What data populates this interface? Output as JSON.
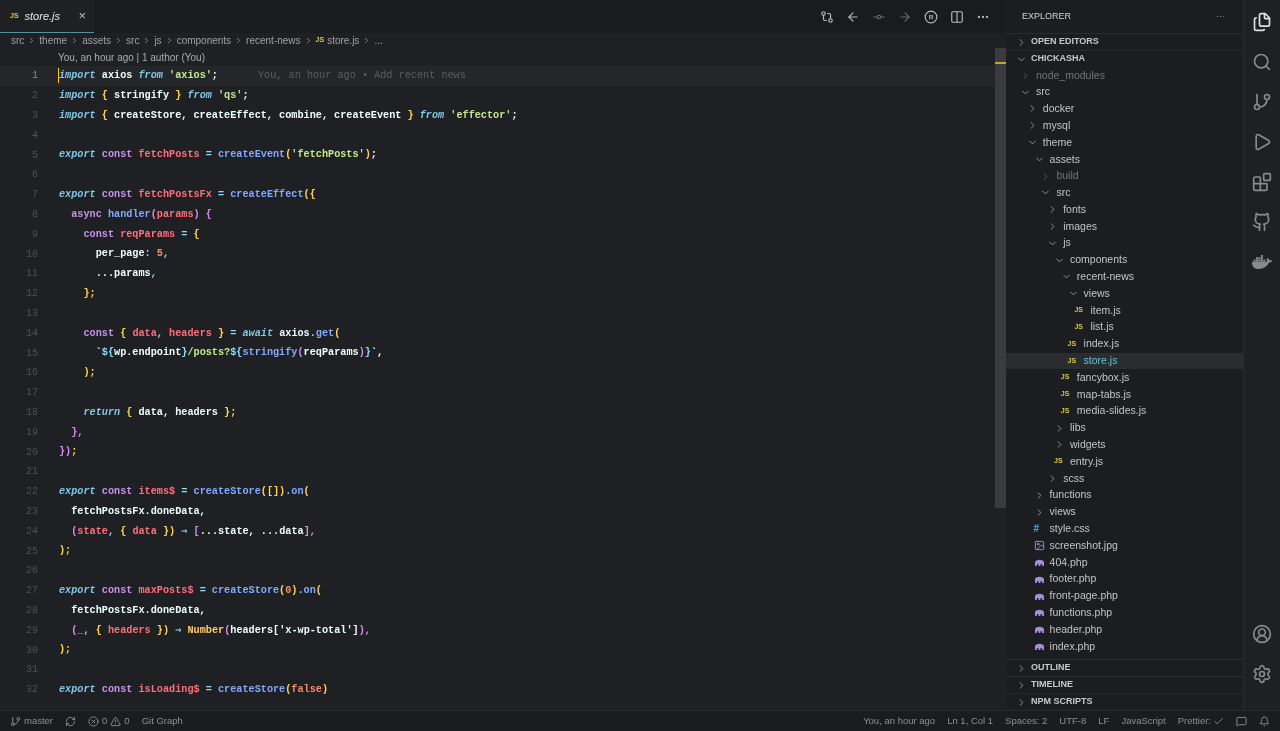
{
  "tab": {
    "icon": "JS",
    "label": "store.js",
    "close": "×",
    "selected": true
  },
  "breadcrumbs": [
    {
      "label": "src"
    },
    {
      "label": "theme"
    },
    {
      "label": "assets"
    },
    {
      "label": "src"
    },
    {
      "label": "js"
    },
    {
      "label": "components"
    },
    {
      "label": "recent-news"
    },
    {
      "label": "store.js",
      "icon": "JS"
    },
    {
      "label": "..."
    }
  ],
  "blame_header": "You, an hour ago | 1 author (You)",
  "inline_blame": "You, an hour ago • Add recent news",
  "code_lines": [
    {
      "n": "1",
      "current": true,
      "tokens": [
        {
          "text": "import ",
          "kind": "keyword"
        },
        {
          "text": "axios ",
          "kind": "plain"
        },
        {
          "text": "from ",
          "kind": "keyword"
        },
        {
          "text": "'axios'",
          "kind": "string"
        },
        {
          "text": ";",
          "kind": "plain"
        }
      ]
    },
    {
      "n": "2",
      "current": false,
      "tokens": [
        {
          "text": "import ",
          "kind": "keyword"
        },
        {
          "text": "{ ",
          "kind": "bracket"
        },
        {
          "text": "stringify ",
          "kind": "plain"
        },
        {
          "text": "} ",
          "kind": "bracket"
        },
        {
          "text": "from ",
          "kind": "keyword"
        },
        {
          "text": "'qs'",
          "kind": "string"
        },
        {
          "text": ";",
          "kind": "plain"
        }
      ]
    },
    {
      "n": "3",
      "current": false,
      "tokens": [
        {
          "text": "import ",
          "kind": "keyword"
        },
        {
          "text": "{ ",
          "kind": "bracket"
        },
        {
          "text": "createStore, createEffect, combine, createEvent ",
          "kind": "plain"
        },
        {
          "text": "} ",
          "kind": "bracket"
        },
        {
          "text": "from ",
          "kind": "keyword"
        },
        {
          "text": "'effector'",
          "kind": "string"
        },
        {
          "text": ";",
          "kind": "plain"
        }
      ]
    },
    {
      "n": "4",
      "current": false
    },
    {
      "n": "5",
      "current": false,
      "tokens": [
        {
          "text": "export ",
          "kind": "keyword"
        },
        {
          "text": "const ",
          "kind": "storage"
        },
        {
          "text": "fetchPosts",
          "kind": "variable"
        },
        {
          "text": " = ",
          "kind": "operator"
        },
        {
          "text": "createEvent",
          "kind": "function"
        },
        {
          "text": "(",
          "kind": "bracket"
        },
        {
          "text": "'fetchPosts'",
          "kind": "string"
        },
        {
          "text": ")",
          "kind": "bracket"
        },
        {
          "text": ";",
          "kind": "plain"
        }
      ]
    },
    {
      "n": "6",
      "current": false
    },
    {
      "n": "7",
      "current": false,
      "tokens": [
        {
          "text": "export ",
          "kind": "keyword"
        },
        {
          "text": "const ",
          "kind": "storage"
        },
        {
          "text": "fetchPostsFx",
          "kind": "variable"
        },
        {
          "text": " = ",
          "kind": "operator"
        },
        {
          "text": "createEffect",
          "kind": "function"
        },
        {
          "text": "({",
          "kind": "bracket"
        }
      ]
    },
    {
      "n": "8",
      "current": false,
      "tokens": [
        {
          "text": "  async ",
          "kind": "storage"
        },
        {
          "text": "handler",
          "kind": "function"
        },
        {
          "text": "(",
          "kind": "paren"
        },
        {
          "text": "params",
          "kind": "variable"
        },
        {
          "text": ") {",
          "kind": "paren"
        }
      ]
    },
    {
      "n": "9",
      "current": false,
      "tokens": [
        {
          "text": "    const ",
          "kind": "storage"
        },
        {
          "text": "reqParams",
          "kind": "variable"
        },
        {
          "text": " = ",
          "kind": "operator"
        },
        {
          "text": "{",
          "kind": "bracket"
        }
      ]
    },
    {
      "n": "10",
      "current": false,
      "tokens": [
        {
          "text": "      per_page",
          "kind": "plain"
        },
        {
          "text": ": ",
          "kind": "operator"
        },
        {
          "text": "5",
          "kind": "number"
        },
        {
          "text": ",",
          "kind": "operator"
        }
      ]
    },
    {
      "n": "11",
      "current": false,
      "tokens": [
        {
          "text": "      ...params",
          "kind": "plain"
        },
        {
          "text": ",",
          "kind": "operator"
        }
      ]
    },
    {
      "n": "12",
      "current": false,
      "tokens": [
        {
          "text": "    };",
          "kind": "bracket"
        }
      ]
    },
    {
      "n": "13",
      "current": false
    },
    {
      "n": "14",
      "current": false,
      "tokens": [
        {
          "text": "    const ",
          "kind": "storage"
        },
        {
          "text": "{ ",
          "kind": "bracket"
        },
        {
          "text": "data",
          "kind": "variable"
        },
        {
          "text": ", ",
          "kind": "operator"
        },
        {
          "text": "headers ",
          "kind": "variable"
        },
        {
          "text": "}",
          "kind": "bracket"
        },
        {
          "text": " = ",
          "kind": "operator"
        },
        {
          "text": "await ",
          "kind": "keyword"
        },
        {
          "text": "axios",
          "kind": "plain"
        },
        {
          "text": ".",
          "kind": "operator"
        },
        {
          "text": "get",
          "kind": "function"
        },
        {
          "text": "(",
          "kind": "bracket"
        }
      ]
    },
    {
      "n": "15",
      "current": false,
      "tokens": [
        {
          "text": "      `",
          "kind": "plain"
        },
        {
          "text": "${",
          "kind": "operator"
        },
        {
          "text": "wp.endpoint",
          "kind": "plain"
        },
        {
          "text": "}",
          "kind": "operator"
        },
        {
          "text": "/posts?",
          "kind": "string"
        },
        {
          "text": "${",
          "kind": "operator"
        },
        {
          "text": "stringify",
          "kind": "function"
        },
        {
          "text": "(",
          "kind": "paren"
        },
        {
          "text": "reqParams",
          "kind": "plain"
        },
        {
          "text": ")",
          "kind": "paren"
        },
        {
          "text": "}",
          "kind": "operator"
        },
        {
          "text": "`,",
          "kind": "plain"
        }
      ]
    },
    {
      "n": "16",
      "current": false,
      "tokens": [
        {
          "text": "    );",
          "kind": "bracket"
        }
      ]
    },
    {
      "n": "17",
      "current": false
    },
    {
      "n": "18",
      "current": false,
      "tokens": [
        {
          "text": "    return ",
          "kind": "keyword"
        },
        {
          "text": "{ ",
          "kind": "bracket"
        },
        {
          "text": "data, headers ",
          "kind": "plain"
        },
        {
          "text": "};",
          "kind": "bracket"
        }
      ]
    },
    {
      "n": "19",
      "current": false,
      "tokens": [
        {
          "text": "  },",
          "kind": "paren"
        }
      ]
    },
    {
      "n": "20",
      "current": false,
      "tokens": [
        {
          "text": "})",
          "kind": "paren"
        },
        {
          "text": ";",
          "kind": "bracket"
        }
      ]
    },
    {
      "n": "21",
      "current": false
    },
    {
      "n": "22",
      "current": false,
      "tokens": [
        {
          "text": "export ",
          "kind": "keyword"
        },
        {
          "text": "const ",
          "kind": "storage"
        },
        {
          "text": "items$",
          "kind": "variable"
        },
        {
          "text": " = ",
          "kind": "operator"
        },
        {
          "text": "createStore",
          "kind": "function"
        },
        {
          "text": "([])",
          "kind": "bracket"
        },
        {
          "text": ".",
          "kind": "operator"
        },
        {
          "text": "on",
          "kind": "function"
        },
        {
          "text": "(",
          "kind": "bracket"
        }
      ]
    },
    {
      "n": "23",
      "current": false,
      "tokens": [
        {
          "text": "  fetchPostsFx.doneData,",
          "kind": "plain"
        }
      ]
    },
    {
      "n": "24",
      "current": false,
      "tokens": [
        {
          "text": "  (",
          "kind": "paren"
        },
        {
          "text": "state",
          "kind": "variable"
        },
        {
          "text": ", ",
          "kind": "operator"
        },
        {
          "text": "{ ",
          "kind": "bracket"
        },
        {
          "text": "data ",
          "kind": "variable"
        },
        {
          "text": "})",
          "kind": "bracket"
        },
        {
          "text": " ⇒ ",
          "kind": "operator"
        },
        {
          "text": "[",
          "kind": "paren"
        },
        {
          "text": "...state, ...data",
          "kind": "plain"
        },
        {
          "text": "],",
          "kind": "paren"
        }
      ]
    },
    {
      "n": "25",
      "current": false,
      "tokens": [
        {
          "text": ");",
          "kind": "bracket"
        }
      ]
    },
    {
      "n": "26",
      "current": false
    },
    {
      "n": "27",
      "current": false,
      "tokens": [
        {
          "text": "export ",
          "kind": "keyword"
        },
        {
          "text": "const ",
          "kind": "storage"
        },
        {
          "text": "maxPosts$",
          "kind": "variable"
        },
        {
          "text": " = ",
          "kind": "operator"
        },
        {
          "text": "createStore",
          "kind": "function"
        },
        {
          "text": "(",
          "kind": "bracket"
        },
        {
          "text": "0",
          "kind": "number"
        },
        {
          "text": ")",
          "kind": "bracket"
        },
        {
          "text": ".",
          "kind": "operator"
        },
        {
          "text": "on",
          "kind": "function"
        },
        {
          "text": "(",
          "kind": "bracket"
        }
      ]
    },
    {
      "n": "28",
      "current": false,
      "tokens": [
        {
          "text": "  fetchPostsFx.doneData,",
          "kind": "plain"
        }
      ]
    },
    {
      "n": "29",
      "current": false,
      "tokens": [
        {
          "text": "  (",
          "kind": "paren"
        },
        {
          "text": "_",
          "kind": "variable"
        },
        {
          "text": ", ",
          "kind": "operator"
        },
        {
          "text": "{ ",
          "kind": "bracket"
        },
        {
          "text": "headers ",
          "kind": "variable"
        },
        {
          "text": "})",
          "kind": "bracket"
        },
        {
          "text": " ⇒ ",
          "kind": "operator"
        },
        {
          "text": "Number",
          "kind": "class"
        },
        {
          "text": "(",
          "kind": "paren"
        },
        {
          "text": "headers['x-wp-total']",
          "kind": "plain"
        },
        {
          "text": "),",
          "kind": "paren"
        }
      ]
    },
    {
      "n": "30",
      "current": false,
      "tokens": [
        {
          "text": ");",
          "kind": "bracket"
        }
      ]
    },
    {
      "n": "31",
      "current": false
    },
    {
      "n": "32",
      "current": false,
      "tokens": [
        {
          "text": "export ",
          "kind": "keyword"
        },
        {
          "text": "const ",
          "kind": "storage"
        },
        {
          "text": "isLoading$",
          "kind": "variable"
        },
        {
          "text": " = ",
          "kind": "operator"
        },
        {
          "text": "createStore",
          "kind": "function"
        },
        {
          "text": "(",
          "kind": "bracket"
        },
        {
          "text": "false",
          "kind": "number"
        },
        {
          "text": ")",
          "kind": "bracket"
        }
      ]
    }
  ],
  "explorer": {
    "title": "EXPLORER",
    "more": "···",
    "sections": [
      {
        "label": "OPEN EDITORS",
        "expanded": false
      },
      {
        "label": "CHICKASHA",
        "expanded": true
      }
    ],
    "tree": [
      {
        "label": "node_modules",
        "kind": "folder",
        "expanded": false,
        "dimmed": true,
        "selected": false
      },
      {
        "label": "src",
        "kind": "folder",
        "expanded": true,
        "dimmed": false,
        "selected": false,
        "children": [
          {
            "label": "docker",
            "kind": "folder",
            "expanded": false,
            "dimmed": false,
            "selected": false
          },
          {
            "label": "mysql",
            "kind": "folder",
            "expanded": false,
            "dimmed": false,
            "selected": false
          },
          {
            "label": "theme",
            "kind": "folder",
            "expanded": true,
            "dimmed": false,
            "selected": false,
            "children": [
              {
                "label": "assets",
                "kind": "folder",
                "expanded": true,
                "dimmed": false,
                "selected": false,
                "children": [
                  {
                    "label": "build",
                    "kind": "folder",
                    "expanded": false,
                    "dimmed": true,
                    "selected": false
                  },
                  {
                    "label": "src",
                    "kind": "folder",
                    "expanded": true,
                    "dimmed": false,
                    "selected": false,
                    "children": [
                      {
                        "label": "fonts",
                        "kind": "folder",
                        "expanded": false,
                        "dimmed": false,
                        "selected": false
                      },
                      {
                        "label": "images",
                        "kind": "folder",
                        "expanded": false,
                        "dimmed": false,
                        "selected": false
                      },
                      {
                        "label": "js",
                        "kind": "folder",
                        "expanded": true,
                        "dimmed": false,
                        "selected": false,
                        "children": [
                          {
                            "label": "components",
                            "kind": "folder",
                            "expanded": true,
                            "dimmed": false,
                            "selected": false,
                            "children": [
                              {
                                "label": "recent-news",
                                "kind": "folder",
                                "expanded": true,
                                "dimmed": false,
                                "selected": false,
                                "children": [
                                  {
                                    "label": "views",
                                    "kind": "folder",
                                    "expanded": true,
                                    "dimmed": false,
                                    "selected": false,
                                    "children": [
                                      {
                                        "label": "item.js",
                                        "kind": "js",
                                        "icon": "JS",
                                        "dimmed": false,
                                        "selected": false
                                      },
                                      {
                                        "label": "list.js",
                                        "kind": "js",
                                        "icon": "JS",
                                        "dimmed": false,
                                        "selected": false
                                      }
                                    ]
                                  },
                                  {
                                    "label": "index.js",
                                    "kind": "js",
                                    "icon": "JS",
                                    "dimmed": false,
                                    "selected": false
                                  },
                                  {
                                    "label": "store.js",
                                    "kind": "js",
                                    "icon": "JS",
                                    "dimmed": false,
                                    "selected": true
                                  }
                                ]
                              },
                              {
                                "label": "fancybox.js",
                                "kind": "js",
                                "icon": "JS",
                                "dimmed": false,
                                "selected": false
                              },
                              {
                                "label": "map-tabs.js",
                                "kind": "js",
                                "icon": "JS",
                                "dimmed": false,
                                "selected": false
                              },
                              {
                                "label": "media-slides.js",
                                "kind": "js",
                                "icon": "JS",
                                "dimmed": false,
                                "selected": false
                              }
                            ]
                          },
                          {
                            "label": "libs",
                            "kind": "folder",
                            "expanded": false,
                            "dimmed": false,
                            "selected": false
                          },
                          {
                            "label": "widgets",
                            "kind": "folder",
                            "expanded": false,
                            "dimmed": false,
                            "selected": false
                          },
                          {
                            "label": "entry.js",
                            "kind": "js",
                            "icon": "JS",
                            "dimmed": false,
                            "selected": false
                          }
                        ]
                      },
                      {
                        "label": "scss",
                        "kind": "folder",
                        "expanded": false,
                        "dimmed": false,
                        "selected": false
                      }
                    ]
                  }
                ]
              },
              {
                "label": "functions",
                "kind": "folder",
                "expanded": false,
                "dimmed": false,
                "selected": false
              },
              {
                "label": "views",
                "kind": "folder",
                "expanded": false,
                "dimmed": false,
                "selected": false
              },
              {
                "label": "style.css",
                "kind": "css",
                "icon": "#",
                "dimmed": false,
                "selected": false
              },
              {
                "label": "screenshot.jpg",
                "kind": "image",
                "dimmed": false,
                "selected": false
              },
              {
                "label": "404.php",
                "kind": "php",
                "dimmed": false,
                "selected": false
              },
              {
                "label": "footer.php",
                "kind": "php",
                "dimmed": false,
                "selected": false
              },
              {
                "label": "front-page.php",
                "kind": "php",
                "dimmed": false,
                "selected": false
              },
              {
                "label": "functions.php",
                "kind": "php",
                "dimmed": false,
                "selected": false
              },
              {
                "label": "header.php",
                "kind": "php",
                "dimmed": false,
                "selected": false
              },
              {
                "label": "index.php",
                "kind": "php",
                "dimmed": false,
                "selected": false
              }
            ]
          }
        ]
      }
    ],
    "bottom_sections": [
      {
        "label": "OUTLINE",
        "expanded": false
      },
      {
        "label": "TIMELINE",
        "expanded": false
      },
      {
        "label": "NPM SCRIPTS",
        "expanded": false
      }
    ]
  },
  "status_bar": {
    "branch": "master",
    "errors": "0",
    "warnings": "0",
    "git_graph": "Git Graph",
    "blame": "You, an hour ago",
    "position": "Ln 1, Col 1",
    "spaces": "Spaces: 2",
    "encoding": "UTF-8",
    "eol": "LF",
    "language": "JavaScript",
    "formatter": "Prettier:"
  }
}
